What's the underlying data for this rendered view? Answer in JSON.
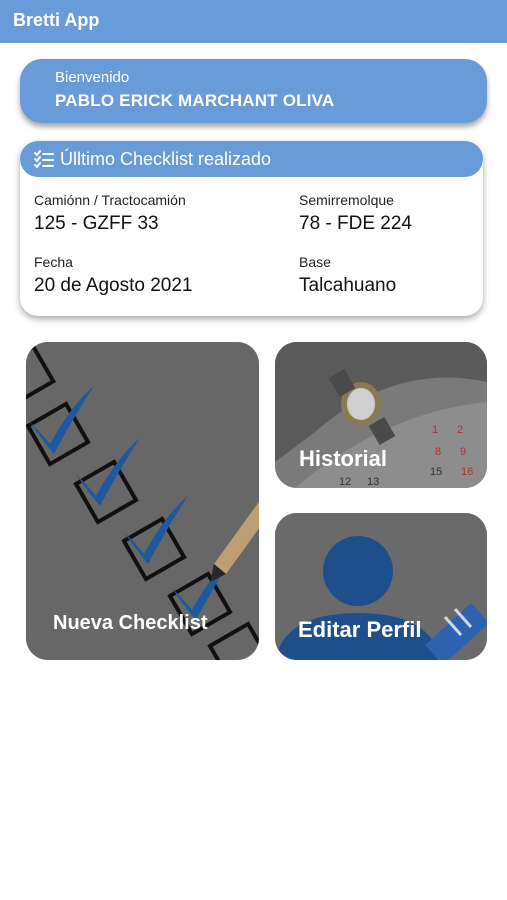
{
  "app": {
    "title": "Bretti App"
  },
  "welcome": {
    "label": "Bienvenido",
    "name": "PABLO ERICK MARCHANT OLIVA"
  },
  "last_checklist": {
    "title": "Úlltimo Checklist realizado",
    "icon": "checklist-icon",
    "truck_label": "Camiónn / Tractocamión",
    "truck_value": "125 - GZFF 33",
    "trailer_label": "Semirremolque",
    "trailer_value": "78 - FDE 224",
    "date_label": "Fecha",
    "date_value": "20 de Agosto 2021",
    "base_label": "Base",
    "base_value": "Talcahuano"
  },
  "tiles": {
    "new_checklist": "Nueva Checklist",
    "history": "Historial",
    "edit_profile": "Editar Perfil",
    "calendar_digits": [
      "1",
      "2",
      "8",
      "9",
      "15",
      "16",
      "12",
      "13"
    ]
  },
  "colors": {
    "primary": "#6a9bd9",
    "tile_bg": "#6b6b6b",
    "icon_blue": "#1e4f8c"
  }
}
